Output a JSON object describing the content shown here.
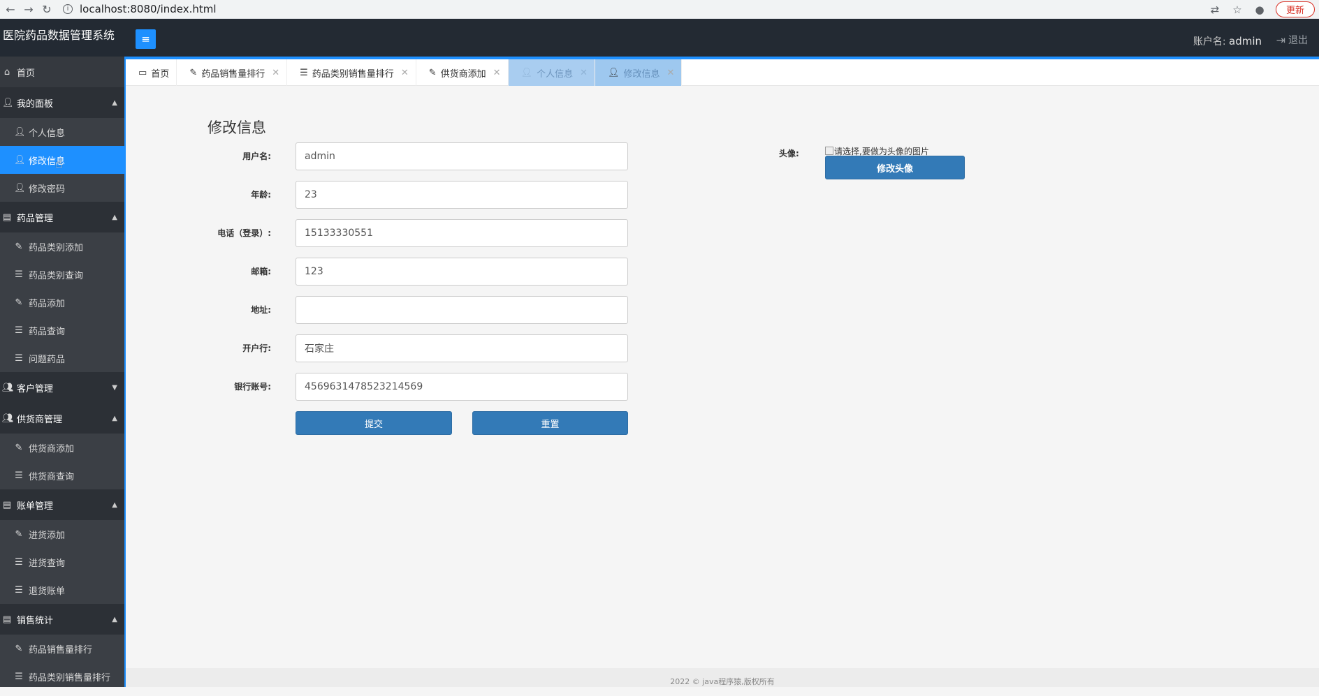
{
  "browser": {
    "url": "localhost:8080/index.html",
    "update_label": "更新"
  },
  "header": {
    "app_title": "医院药品数据管理系统",
    "menu_icon": "hamburger-icon",
    "account_label": "账户名:",
    "account_name": "admin",
    "logout_label": "退出"
  },
  "sidebar": {
    "home": "首页",
    "groups": {
      "my_panel": "我的面板",
      "drug_mgmt": "药品管理",
      "customer_mgmt": "客户管理",
      "supplier_mgmt": "供货商管理",
      "bill_mgmt": "账单管理",
      "sales_stats": "销售统计"
    },
    "items": {
      "personal_info": "个人信息",
      "edit_info": "修改信息",
      "change_password": "修改密码",
      "drug_category_add": "药品类别添加",
      "drug_category_query": "药品类别查询",
      "drug_add": "药品添加",
      "drug_query": "药品查询",
      "problem_drug": "问题药品",
      "supplier_add": "供货商添加",
      "supplier_query": "供货商查询",
      "purchase_add": "进货添加",
      "purchase_query": "进货查询",
      "return_bill": "退货账单",
      "drug_sales_rank": "药品销售量排行",
      "drug_category_sales_rank": "药品类别销售量排行"
    }
  },
  "tabs": [
    {
      "label": "首页"
    },
    {
      "label": "药品销售量排行"
    },
    {
      "label": "药品类别销售量排行"
    },
    {
      "label": "供货商添加"
    },
    {
      "label": "个人信息"
    },
    {
      "label": "修改信息"
    }
  ],
  "form": {
    "heading": "修改信息",
    "username_label": "用户名:",
    "username_value": "admin",
    "age_label": "年龄:",
    "age_value": "23",
    "phone_label": "电话（登录）:",
    "phone_value": "15133330551",
    "email_label": "邮箱:",
    "email_value": "123",
    "address_label": "地址:",
    "address_value": "",
    "bank_label": "开户行:",
    "bank_value": "石家庄",
    "account_label": "银行账号:",
    "account_value": "4569631478523214569",
    "submit_label": "提交",
    "reset_label": "重置",
    "avatar_label": "头像:",
    "avatar_alt": "请选择,要做为头像的图片",
    "avatar_button": "修改头像"
  },
  "footer": {
    "text": "2022 © java程序猿,版权所有"
  },
  "colors": {
    "accent": "#1e90ff",
    "header_bg": "#232a33",
    "sidebar_bg": "#3b3f45",
    "button": "#337ab7"
  }
}
